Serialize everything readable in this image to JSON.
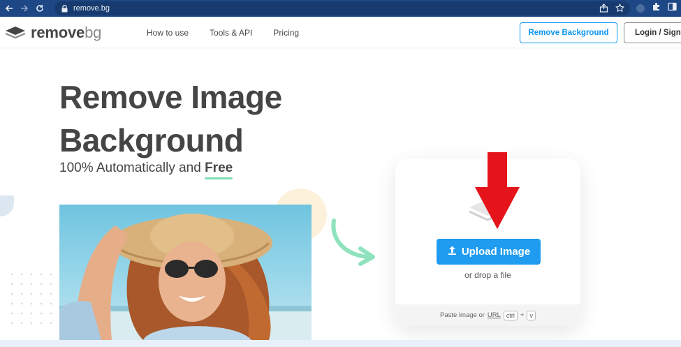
{
  "browser": {
    "url": "remove.bg"
  },
  "header": {
    "logo_remove": "remove",
    "logo_bg": "bg",
    "nav": [
      "How to use",
      "Tools & API",
      "Pricing"
    ],
    "remove_bg_button": "Remove Background",
    "login_button": "Login / Sign Up"
  },
  "hero": {
    "title_line1": "Remove Image",
    "title_line2": "Background",
    "subtitle_prefix": "100% Automatically and ",
    "subtitle_free": "Free"
  },
  "upload": {
    "button_label": "Upload Image",
    "drop_text": "or drop a file",
    "paste_prefix": "Paste image or",
    "paste_url": "URL",
    "key_ctrl": "ctrl",
    "key_plus": "+",
    "key_v": "v"
  },
  "colors": {
    "brand_blue": "#1f9bf0",
    "browser_bar": "#1e4785",
    "accent_green": "#7ee0b5",
    "annotation_red": "#e5141a"
  },
  "icons": [
    "back-arrow-icon",
    "forward-arrow-icon",
    "reload-icon",
    "lock-icon",
    "share-icon",
    "star-icon",
    "extensions-icon",
    "sidebar-icon",
    "layers-icon",
    "upload-icon"
  ]
}
